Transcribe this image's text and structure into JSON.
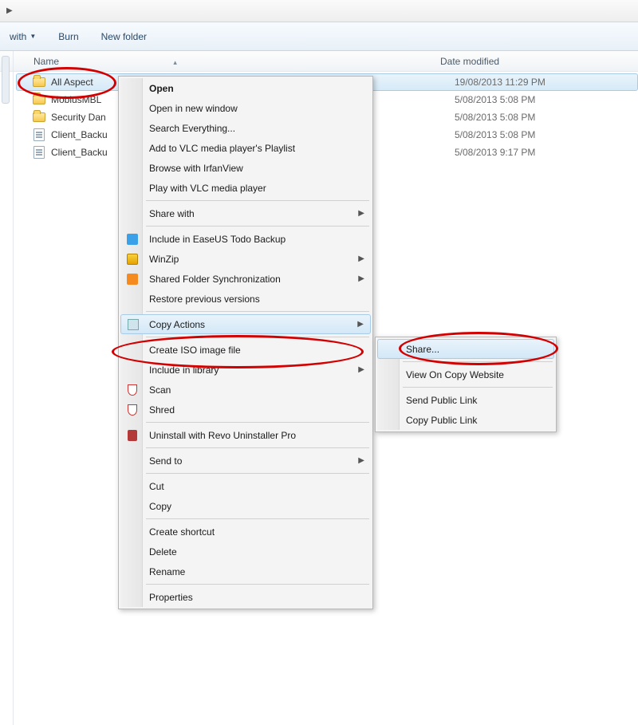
{
  "toolbar": {
    "with_label": "with",
    "burn_label": "Burn",
    "newfolder_label": "New folder"
  },
  "columns": {
    "name": "Name",
    "date": "Date modified"
  },
  "files": [
    {
      "name": "All Aspect",
      "date": "19/08/2013 11:29 PM",
      "type": "folder",
      "selected": true
    },
    {
      "name": "MobiusMBL",
      "date": "5/08/2013 5:08 PM",
      "type": "folder",
      "selected": false
    },
    {
      "name": "Security Dan",
      "date": "5/08/2013 5:08 PM",
      "type": "folder",
      "selected": false
    },
    {
      "name": "Client_Backu",
      "date": "5/08/2013 5:08 PM",
      "type": "file",
      "selected": false
    },
    {
      "name": "Client_Backu",
      "date": "5/08/2013 9:17 PM",
      "type": "file",
      "selected": false
    }
  ],
  "context_menu": {
    "items": [
      {
        "label": "Open",
        "bold": true
      },
      {
        "label": "Open in new window"
      },
      {
        "label": "Search Everything..."
      },
      {
        "label": "Add to VLC media player's Playlist"
      },
      {
        "label": "Browse with IrfanView"
      },
      {
        "label": "Play with VLC media player"
      },
      {
        "sep": true
      },
      {
        "label": "Share with",
        "submenu": true
      },
      {
        "sep": true
      },
      {
        "label": "Include in EaseUS Todo Backup",
        "icon": "easeus"
      },
      {
        "label": "WinZip",
        "submenu": true,
        "icon": "winzip"
      },
      {
        "label": "Shared Folder Synchronization",
        "submenu": true,
        "icon": "sync"
      },
      {
        "label": "Restore previous versions"
      },
      {
        "sep": true
      },
      {
        "label": "Copy Actions",
        "submenu": true,
        "icon": "copyact",
        "hover": true
      },
      {
        "sep": true
      },
      {
        "label": "Create ISO image file"
      },
      {
        "label": "Include in library",
        "submenu": true
      },
      {
        "label": "Scan",
        "icon": "shield"
      },
      {
        "label": "Shred",
        "icon": "shield"
      },
      {
        "sep": true
      },
      {
        "label": "Uninstall with Revo Uninstaller Pro",
        "icon": "revo"
      },
      {
        "sep": true
      },
      {
        "label": "Send to",
        "submenu": true
      },
      {
        "sep": true
      },
      {
        "label": "Cut"
      },
      {
        "label": "Copy"
      },
      {
        "sep": true
      },
      {
        "label": "Create shortcut"
      },
      {
        "label": "Delete"
      },
      {
        "label": "Rename"
      },
      {
        "sep": true
      },
      {
        "label": "Properties"
      }
    ]
  },
  "submenu": {
    "items": [
      {
        "label": "Share...",
        "hover": true
      },
      {
        "sep": true
      },
      {
        "label": "View On Copy Website"
      },
      {
        "sep": true
      },
      {
        "label": "Send Public Link"
      },
      {
        "label": "Copy Public Link"
      }
    ]
  }
}
